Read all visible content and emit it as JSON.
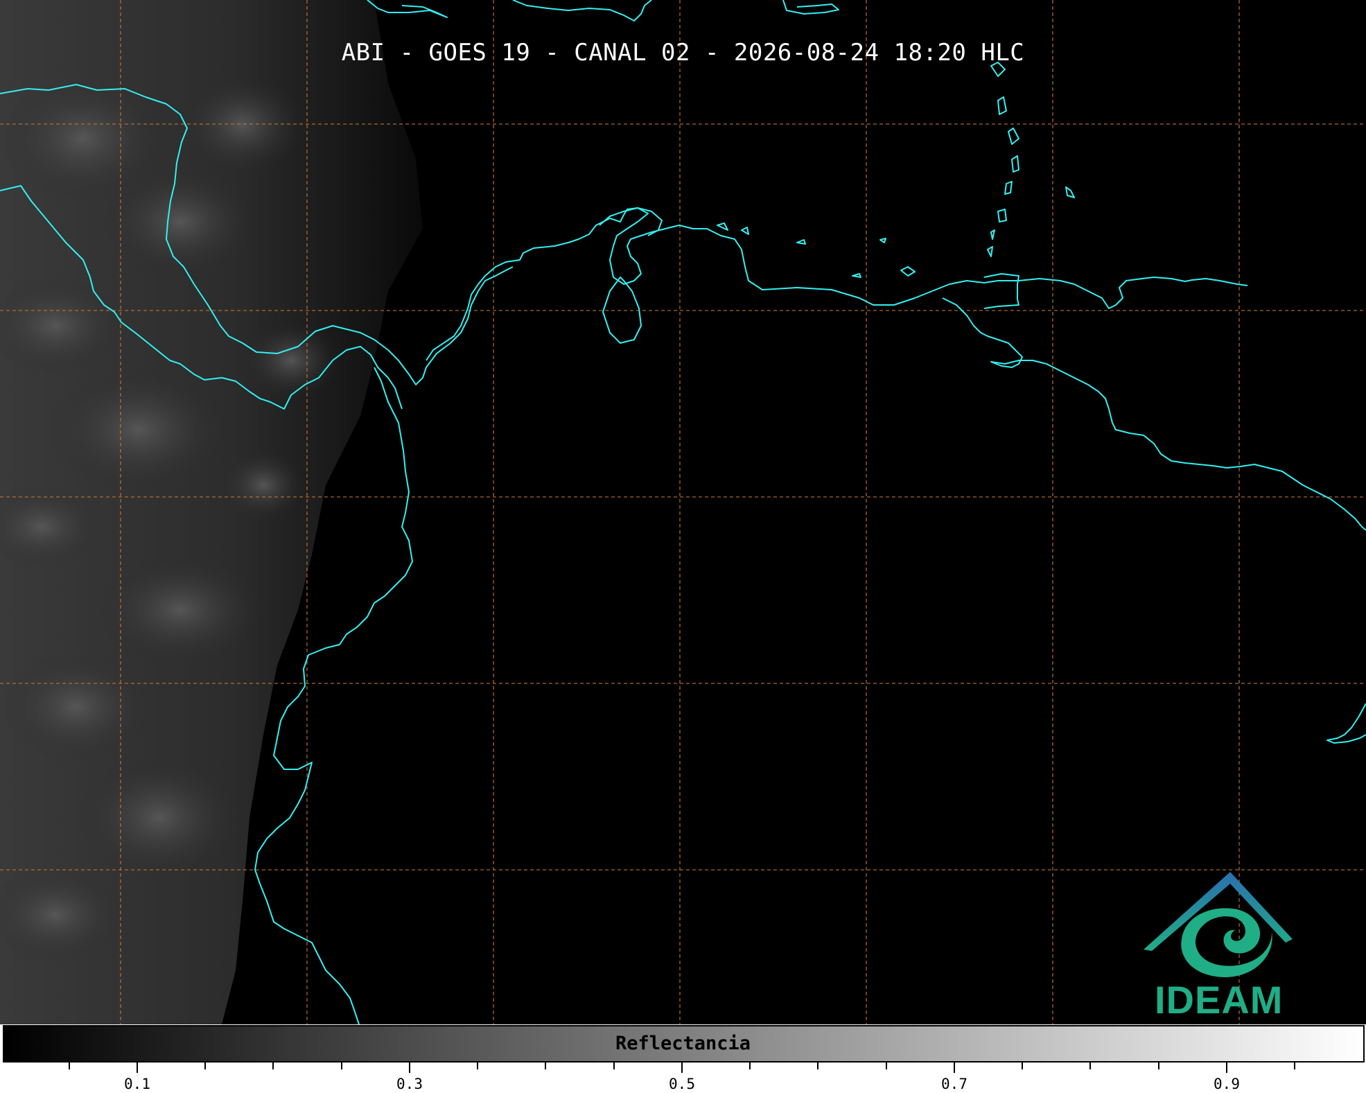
{
  "map": {
    "title": "ABI - GOES 19 - CANAL 02 - 2026-08-24 18:20 HLC",
    "coastline_color": "#33f0f0",
    "gridline_color": "#c87832",
    "background_color": "#000000"
  },
  "colorbar": {
    "label": "Reflectancia",
    "range": [
      0.0,
      1.0
    ],
    "colormap": "gray",
    "tick_labels": [
      "0.1",
      "0.3",
      "0.5",
      "0.7",
      "0.9"
    ],
    "tick_values": [
      0.1,
      0.3,
      0.5,
      0.7,
      0.9
    ]
  },
  "logo": {
    "text": "IDEAM",
    "colors": [
      "#2a6fb0",
      "#1fae86"
    ]
  }
}
